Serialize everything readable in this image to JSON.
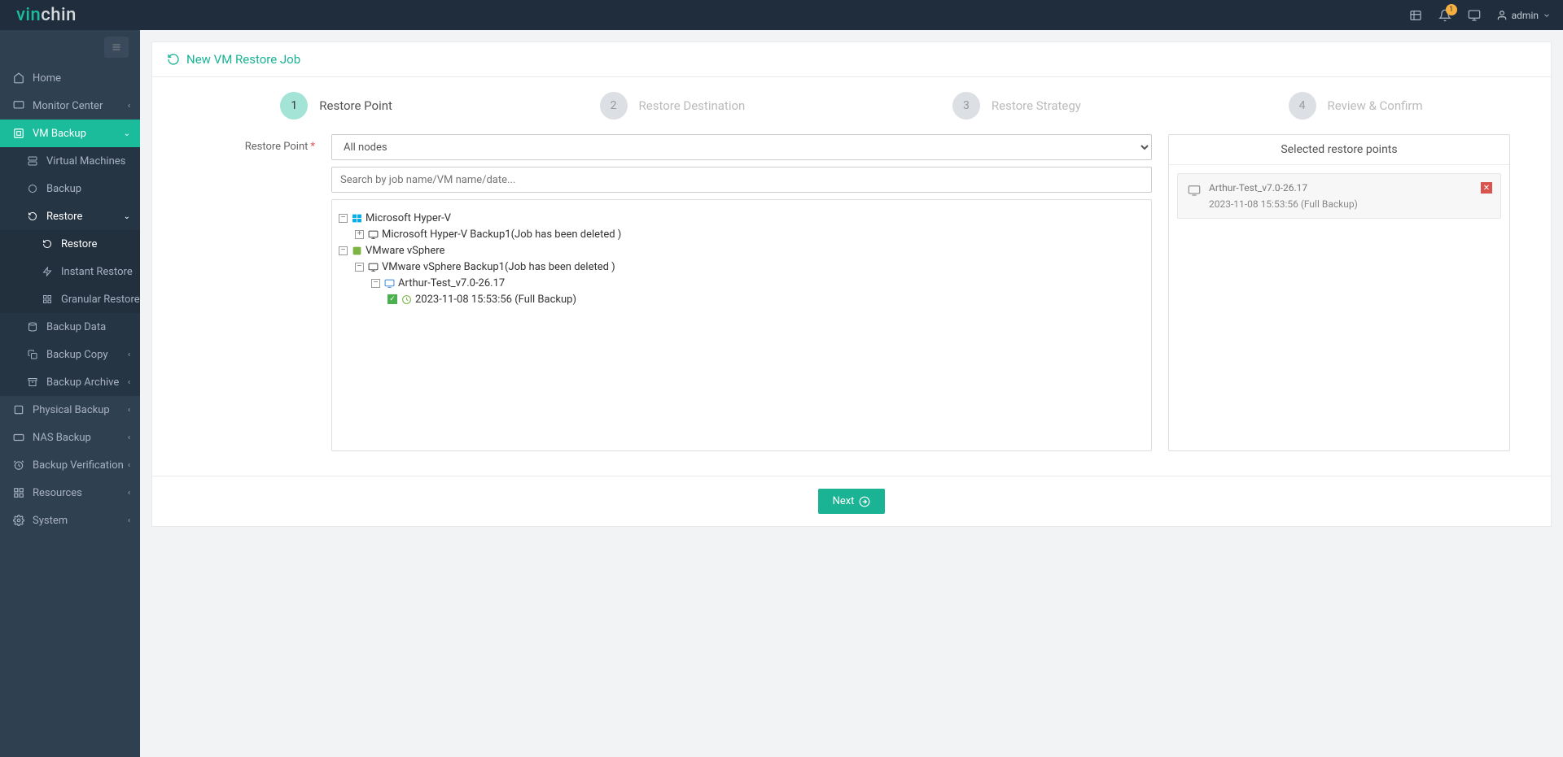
{
  "brand": {
    "part1": "vin",
    "part2": "chin"
  },
  "topbar": {
    "notification_count": "1",
    "user": "admin"
  },
  "sidebar": {
    "home": "Home",
    "monitor": "Monitor Center",
    "vmbackup": "VM Backup",
    "vm": "Virtual Machines",
    "backup": "Backup",
    "restore": "Restore",
    "restore_sub": "Restore",
    "instant": "Instant Restore",
    "granular": "Granular Restore",
    "backupdata": "Backup Data",
    "backupcopy": "Backup Copy",
    "backuparchive": "Backup Archive",
    "physical": "Physical Backup",
    "nas": "NAS Backup",
    "verification": "Backup Verification",
    "resources": "Resources",
    "system": "System"
  },
  "page": {
    "title": "New VM Restore Job",
    "steps": {
      "s1n": "1",
      "s1": "Restore Point",
      "s2n": "2",
      "s2": "Restore Destination",
      "s3n": "3",
      "s3": "Restore Strategy",
      "s4n": "4",
      "s4": "Review & Confirm"
    },
    "field_label": "Restore Point",
    "select_value": "All nodes",
    "search_placeholder": "Search by job name/VM name/date...",
    "tree": {
      "hyperv": "Microsoft Hyper-V",
      "hyperv_job": "Microsoft Hyper-V Backup1(Job has been deleted )",
      "vmware": "VMware vSphere",
      "vmware_job": "VMware vSphere Backup1(Job has been deleted )",
      "vm": "Arthur-Test_v7.0-26.17",
      "point": "2023-11-08 15:53:56 (Full  Backup)"
    },
    "selected_header": "Selected restore points",
    "selected": {
      "name": "Arthur-Test_v7.0-26.17",
      "time": "2023-11-08 15:53:56 (Full Backup)"
    },
    "next": "Next"
  }
}
